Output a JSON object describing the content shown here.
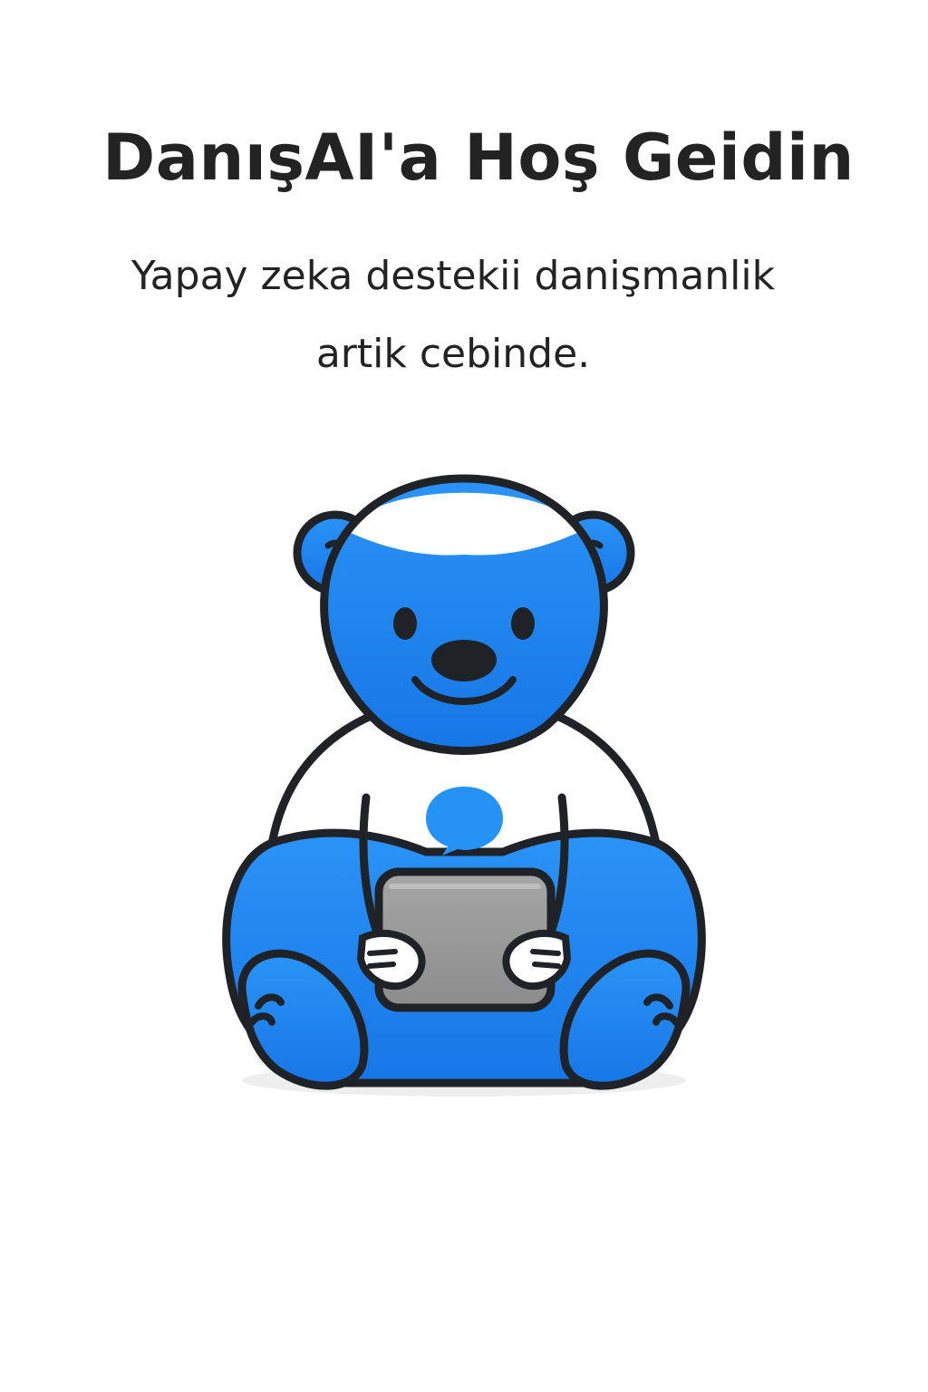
{
  "welcome": {
    "title": "DanışAI'a Hoş Geidin",
    "subtitle_line1": "Yapay zeka destekii danişmanlik",
    "subtitle_line2": "artik cebinde."
  },
  "mascot": {
    "icon": "bear-mascot-icon",
    "shirt_icon": "chat-bubble-icon",
    "held_item_icon": "tablet-icon"
  },
  "colors": {
    "background": "#ffffff",
    "text": "#232323",
    "bear_blue": "#1e8cf0",
    "outline": "#1f2328",
    "tablet_gray": "#9a9a9a"
  }
}
